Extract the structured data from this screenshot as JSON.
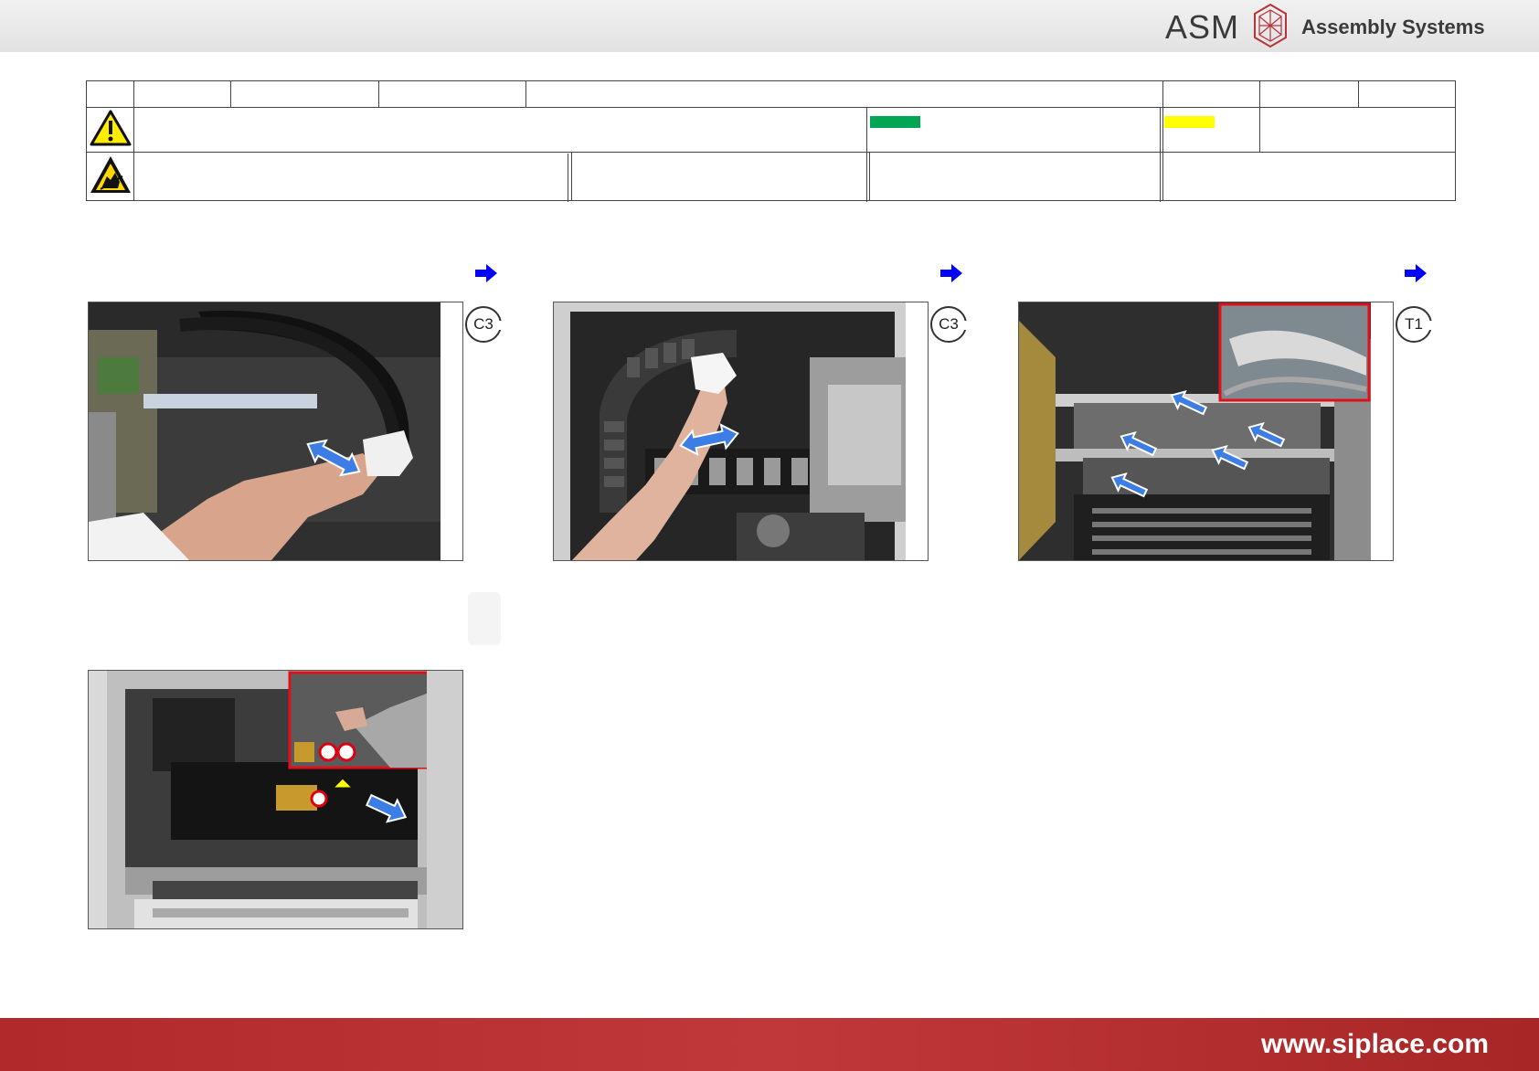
{
  "header": {
    "brand": "ASM",
    "brand_sub": "Assembly Systems",
    "logo_icon": "asm-logo-icon"
  },
  "info_table": {
    "warning_icon": "warning-triangle-icon",
    "esd_icon": "esd-hand-icon",
    "status_colors": {
      "green": "#00a651",
      "yellow": "#ffff00"
    }
  },
  "steps": [
    {
      "badge": "C3",
      "arrow_icon": "blue-right-arrow-icon",
      "photo_icon": "cable-chain-cleaning-photo"
    },
    {
      "badge": "C3",
      "arrow_icon": "blue-right-arrow-icon",
      "photo_icon": "cable-chain-wiping-photo"
    },
    {
      "badge": "T1",
      "arrow_icon": "blue-right-arrow-icon",
      "photo_icon": "conveyor-rails-photo"
    },
    {
      "badge": "",
      "arrow_icon": "",
      "photo_icon": "gantry-module-photo"
    }
  ],
  "footer": {
    "url": "www.siplace.com"
  },
  "colors": {
    "accent_blue": "#1b5fd6",
    "arrow_blue": "#0000ff",
    "footer_red": "#b02a2a",
    "highlight_red": "#e0101a"
  }
}
